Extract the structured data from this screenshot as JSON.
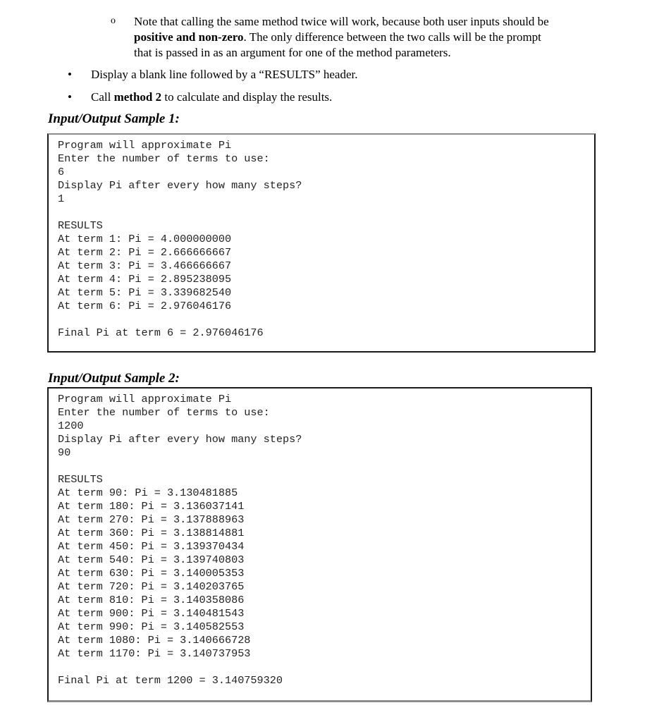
{
  "document": {
    "sub_bullet": {
      "marker": "o",
      "line1": "Note that calling the same method twice will work, because both user inputs should be",
      "line2_bold": "positive and non-zero",
      "line2_rest": ".  The only difference between the two calls will be the prompt",
      "line3": "that is passed in as an argument for one of the method parameters."
    },
    "bullets": [
      {
        "marker": "•",
        "text": "Display a blank line followed by a “RESULTS” header."
      },
      {
        "marker": "•",
        "prefix": "Call ",
        "bold": "method 2",
        "suffix": " to calculate and display the results."
      }
    ],
    "samples": [
      {
        "heading": "Input/Output Sample 1:",
        "lines": [
          "Program will approximate Pi",
          "Enter the number of terms to use:",
          "6",
          "Display Pi after every how many steps?",
          "1",
          "",
          "RESULTS",
          "At term 1: Pi = 4.000000000",
          "At term 2: Pi = 2.666666667",
          "At term 3: Pi = 3.466666667",
          "At term 4: Pi = 2.895238095",
          "At term 5: Pi = 3.339682540",
          "At term 6: Pi = 2.976046176",
          "",
          "Final Pi at term 6 = 2.976046176"
        ]
      },
      {
        "heading": "Input/Output Sample 2:",
        "lines": [
          "Program will approximate Pi",
          "Enter the number of terms to use:",
          "1200",
          "Display Pi after every how many steps?",
          "90",
          "",
          "RESULTS",
          "At term 90: Pi = 3.130481885",
          "At term 180: Pi = 3.136037141",
          "At term 270: Pi = 3.137888963",
          "At term 360: Pi = 3.138814881",
          "At term 450: Pi = 3.139370434",
          "At term 540: Pi = 3.139740803",
          "At term 630: Pi = 3.140005353",
          "At term 720: Pi = 3.140203765",
          "At term 810: Pi = 3.140358086",
          "At term 900: Pi = 3.140481543",
          "At term 990: Pi = 3.140582553",
          "At term 1080: Pi = 3.140666728",
          "At term 1170: Pi = 3.140737953",
          "",
          "Final Pi at term 1200 = 3.140759320"
        ]
      }
    ]
  }
}
